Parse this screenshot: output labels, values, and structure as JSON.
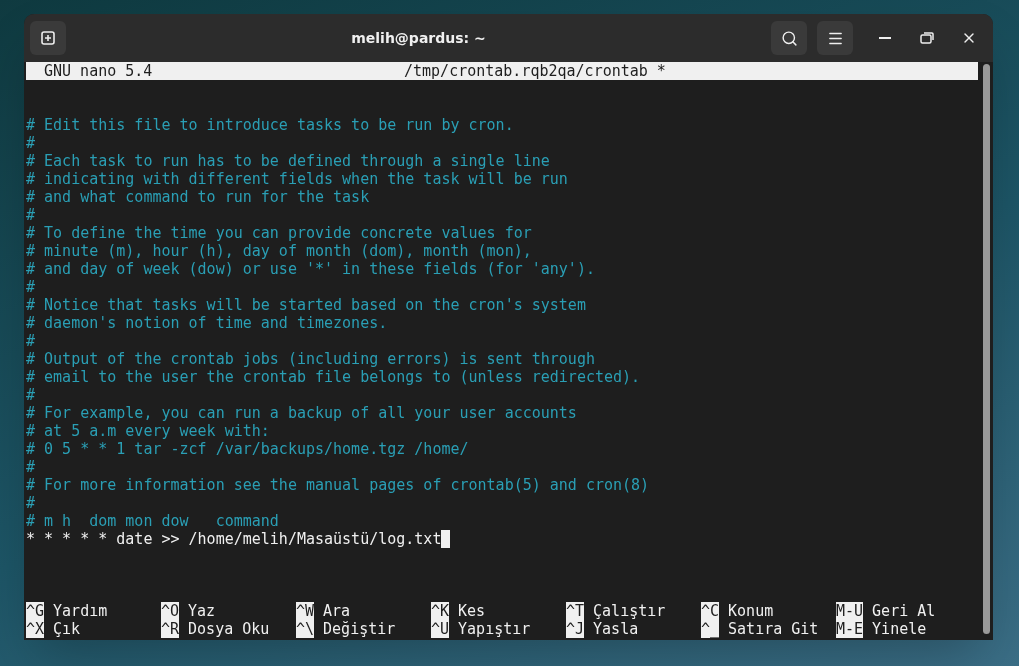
{
  "window": {
    "title": "melih@pardus: ~"
  },
  "nano": {
    "version": "GNU nano 5.4",
    "file": "/tmp/crontab.rqb2qa/crontab *"
  },
  "lines": [
    {
      "kind": "comment",
      "text": "# Edit this file to introduce tasks to be run by cron."
    },
    {
      "kind": "comment",
      "text": "#"
    },
    {
      "kind": "comment",
      "text": "# Each task to run has to be defined through a single line"
    },
    {
      "kind": "comment",
      "text": "# indicating with different fields when the task will be run"
    },
    {
      "kind": "comment",
      "text": "# and what command to run for the task"
    },
    {
      "kind": "comment",
      "text": "#"
    },
    {
      "kind": "comment",
      "text": "# To define the time you can provide concrete values for"
    },
    {
      "kind": "comment",
      "text": "# minute (m), hour (h), day of month (dom), month (mon),"
    },
    {
      "kind": "comment",
      "text": "# and day of week (dow) or use '*' in these fields (for 'any')."
    },
    {
      "kind": "comment",
      "text": "#"
    },
    {
      "kind": "comment",
      "text": "# Notice that tasks will be started based on the cron's system"
    },
    {
      "kind": "comment",
      "text": "# daemon's notion of time and timezones."
    },
    {
      "kind": "comment",
      "text": "#"
    },
    {
      "kind": "comment",
      "text": "# Output of the crontab jobs (including errors) is sent through"
    },
    {
      "kind": "comment",
      "text": "# email to the user the crontab file belongs to (unless redirected)."
    },
    {
      "kind": "comment",
      "text": "#"
    },
    {
      "kind": "comment",
      "text": "# For example, you can run a backup of all your user accounts"
    },
    {
      "kind": "comment",
      "text": "# at 5 a.m every week with:"
    },
    {
      "kind": "comment",
      "text": "# 0 5 * * 1 tar -zcf /var/backups/home.tgz /home/"
    },
    {
      "kind": "comment",
      "text": "#"
    },
    {
      "kind": "comment",
      "text": "# For more information see the manual pages of crontab(5) and cron(8)"
    },
    {
      "kind": "comment",
      "text": "#"
    },
    {
      "kind": "comment",
      "text": "# m h  dom mon dow   command"
    },
    {
      "kind": "command",
      "text": "* * * * * date >> /home/melih/Masaüstü/log.txt"
    }
  ],
  "shortcuts": [
    [
      {
        "key": "^G",
        "label": "Yardım"
      },
      {
        "key": "^O",
        "label": "Yaz"
      },
      {
        "key": "^W",
        "label": "Ara"
      },
      {
        "key": "^K",
        "label": "Kes"
      },
      {
        "key": "^T",
        "label": "Çalıştır"
      },
      {
        "key": "^C",
        "label": "Konum"
      },
      {
        "key": "M-U",
        "label": "Geri Al"
      }
    ],
    [
      {
        "key": "^X",
        "label": "Çık"
      },
      {
        "key": "^R",
        "label": "Dosya Oku"
      },
      {
        "key": "^\\",
        "label": "Değiştir"
      },
      {
        "key": "^U",
        "label": "Yapıştır"
      },
      {
        "key": "^J",
        "label": "Yasla"
      },
      {
        "key": "^_",
        "label": "Satıra Git"
      },
      {
        "key": "M-E",
        "label": "Yinele"
      }
    ]
  ]
}
